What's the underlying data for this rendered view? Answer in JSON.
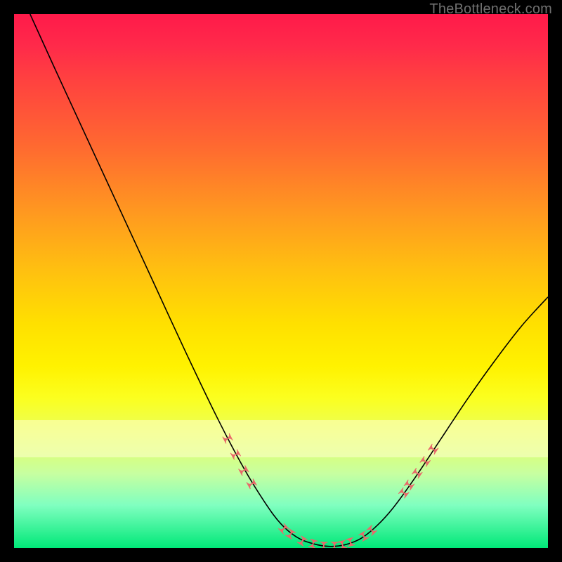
{
  "watermark": "TheBottleneck.com",
  "colors": {
    "marker": "#e86a6a",
    "curve": "#000000"
  },
  "chart_data": {
    "type": "line",
    "title": "",
    "xlabel": "",
    "ylabel": "",
    "xlim": [
      0,
      100
    ],
    "ylim": [
      0,
      100
    ],
    "grid": false,
    "legend": false,
    "note": "Bottleneck-style V curve. y ≈ mismatch percentage (0 at bottom). No numeric axis ticks rendered.",
    "curve_points": [
      {
        "x": 3.0,
        "y": 100.0
      },
      {
        "x": 8.0,
        "y": 89.0
      },
      {
        "x": 14.0,
        "y": 76.0
      },
      {
        "x": 20.0,
        "y": 63.0
      },
      {
        "x": 26.0,
        "y": 50.0
      },
      {
        "x": 32.0,
        "y": 37.0
      },
      {
        "x": 38.0,
        "y": 24.5
      },
      {
        "x": 43.0,
        "y": 15.0
      },
      {
        "x": 47.0,
        "y": 8.5
      },
      {
        "x": 50.0,
        "y": 4.5
      },
      {
        "x": 53.0,
        "y": 2.0
      },
      {
        "x": 56.0,
        "y": 0.8
      },
      {
        "x": 59.0,
        "y": 0.3
      },
      {
        "x": 62.0,
        "y": 0.6
      },
      {
        "x": 65.0,
        "y": 1.8
      },
      {
        "x": 68.0,
        "y": 4.2
      },
      {
        "x": 71.0,
        "y": 7.5
      },
      {
        "x": 75.0,
        "y": 13.0
      },
      {
        "x": 80.0,
        "y": 20.5
      },
      {
        "x": 85.0,
        "y": 28.0
      },
      {
        "x": 90.0,
        "y": 35.0
      },
      {
        "x": 95.0,
        "y": 41.5
      },
      {
        "x": 100.0,
        "y": 47.0
      }
    ],
    "markers": [
      {
        "x": 40.0,
        "y": 20.5
      },
      {
        "x": 41.5,
        "y": 17.5
      },
      {
        "x": 43.0,
        "y": 14.5
      },
      {
        "x": 44.5,
        "y": 12.0
      },
      {
        "x": 50.5,
        "y": 3.6
      },
      {
        "x": 51.8,
        "y": 2.6
      },
      {
        "x": 54.0,
        "y": 1.3
      },
      {
        "x": 56.0,
        "y": 0.8
      },
      {
        "x": 58.0,
        "y": 0.4
      },
      {
        "x": 60.0,
        "y": 0.4
      },
      {
        "x": 61.5,
        "y": 0.6
      },
      {
        "x": 63.0,
        "y": 1.1
      },
      {
        "x": 65.5,
        "y": 2.2
      },
      {
        "x": 67.0,
        "y": 3.3
      },
      {
        "x": 73.0,
        "y": 10.3
      },
      {
        "x": 74.0,
        "y": 11.8
      },
      {
        "x": 75.5,
        "y": 14.0
      },
      {
        "x": 77.0,
        "y": 16.2
      },
      {
        "x": 78.5,
        "y": 18.5
      }
    ],
    "light_band_y": [
      17,
      24
    ]
  }
}
